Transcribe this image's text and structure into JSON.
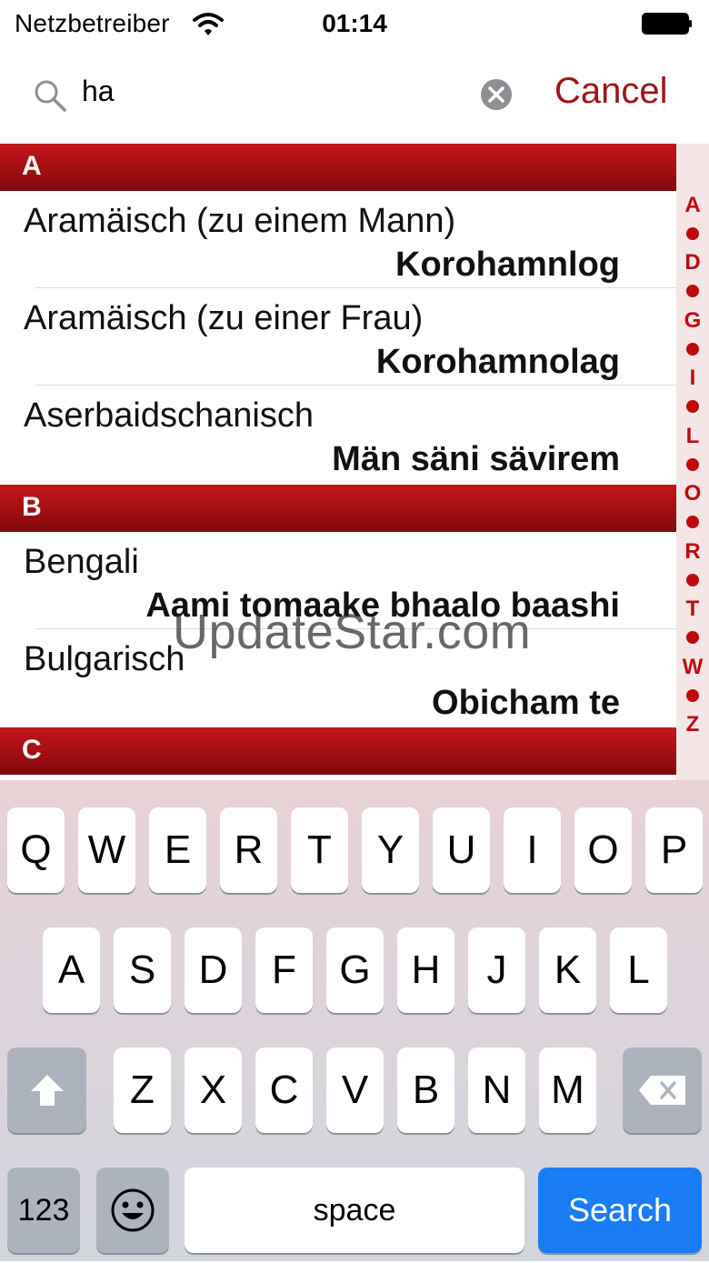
{
  "status_bar": {
    "carrier": "Netzbetreiber",
    "time": "01:14"
  },
  "search": {
    "query": "ha",
    "cancel_label": "Cancel"
  },
  "sections": [
    {
      "letter": "A",
      "rows": [
        {
          "language": "Aramäisch (zu einem Mann)",
          "phrase": "Korohamnlog"
        },
        {
          "language": "Aramäisch (zu einer Frau)",
          "phrase": "Korohamnolag"
        },
        {
          "language": "Aserbaidschanisch",
          "phrase": "Män säni sävirem"
        }
      ]
    },
    {
      "letter": "B",
      "rows": [
        {
          "language": "Bengali",
          "phrase": "Aami tomaake bhaalo baashi"
        },
        {
          "language": "Bulgarisch",
          "phrase": "Obicham te"
        }
      ]
    },
    {
      "letter": "C",
      "rows": []
    }
  ],
  "index_letters": [
    "A",
    "D",
    "G",
    "I",
    "L",
    "O",
    "R",
    "T",
    "W",
    "Z"
  ],
  "keyboard": {
    "row1": [
      "Q",
      "W",
      "E",
      "R",
      "T",
      "Y",
      "U",
      "I",
      "O",
      "P"
    ],
    "row2": [
      "A",
      "S",
      "D",
      "F",
      "G",
      "H",
      "J",
      "K",
      "L"
    ],
    "row3": [
      "Z",
      "X",
      "C",
      "V",
      "B",
      "N",
      "M"
    ],
    "numbers_label": "123",
    "space_label": "space",
    "search_label": "Search"
  },
  "watermark": "UpdateStar.com",
  "colors": {
    "accent": "#a01419",
    "header_red": "#a10e12",
    "search_key": "#1a7cf5"
  }
}
